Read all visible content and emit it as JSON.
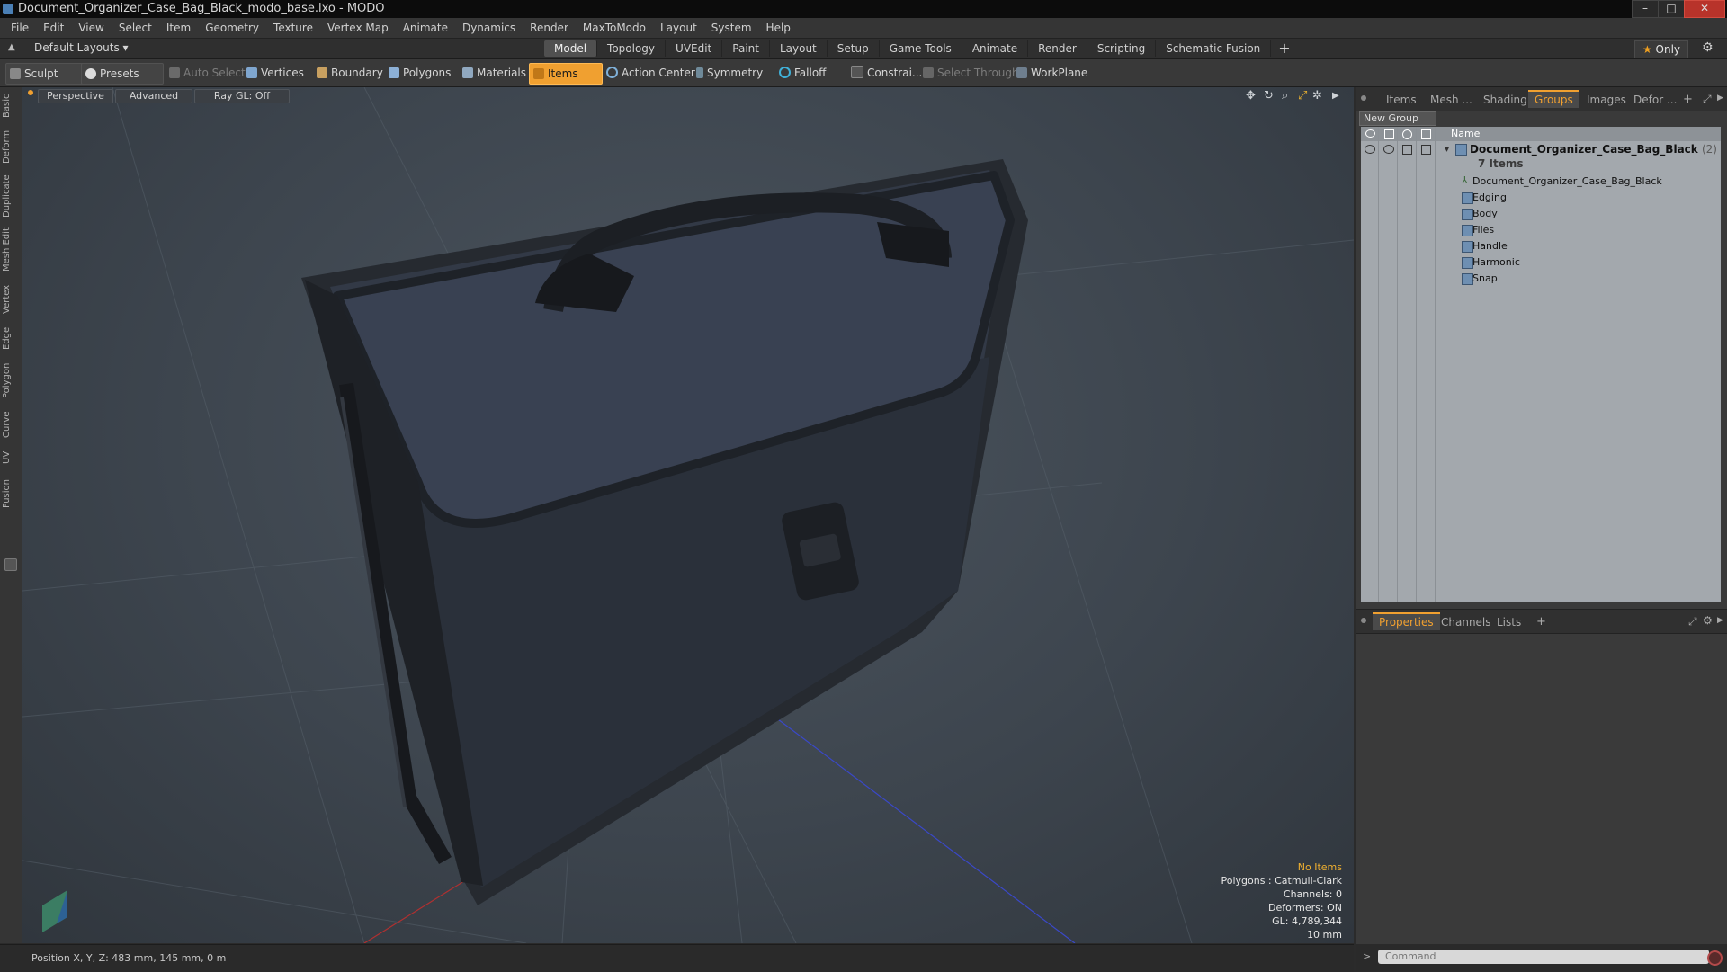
{
  "window": {
    "title": "Document_Organizer_Case_Bag_Black_modo_base.lxo - MODO",
    "controls": [
      "–",
      "□",
      "✕"
    ]
  },
  "menu": [
    "File",
    "Edit",
    "View",
    "Select",
    "Item",
    "Geometry",
    "Texture",
    "Vertex Map",
    "Animate",
    "Dynamics",
    "Render",
    "MaxToModo",
    "Layout",
    "System",
    "Help"
  ],
  "layoutbar": {
    "layout": "Default Layouts ▾",
    "tabs": [
      "Model",
      "Topology",
      "UVEdit",
      "Paint",
      "Layout",
      "Setup",
      "Game Tools",
      "Animate",
      "Render",
      "Scripting",
      "Schematic Fusion"
    ],
    "active_tab": "Model",
    "add": "+",
    "only": "Only"
  },
  "toolbar": {
    "sculpt": "Sculpt",
    "presets": "Presets",
    "auto_select": "Auto Select",
    "vertices": "Vertices",
    "boundary": "Boundary",
    "polygons": "Polygons",
    "materials": "Materials",
    "items": "Items",
    "action_center": "Action Center",
    "symmetry": "Symmetry",
    "falloff": "Falloff",
    "constraints": "Constrai...",
    "select_through": "Select Through",
    "workplane": "WorkPlane"
  },
  "left_tabs": [
    "Basic",
    "Deform",
    "Duplicate",
    "Mesh Edit",
    "Vertex",
    "Edge",
    "Polygon",
    "Curve",
    "UV",
    "Fusion"
  ],
  "viewport": {
    "view": "Perspective",
    "shading": "Advanced",
    "raygl": "Ray GL: Off",
    "info": {
      "selection": "No Items",
      "polygons": "Polygons : Catmull-Clark",
      "channels": "Channels: 0",
      "deformers": "Deformers: ON",
      "gl": "GL: 4,789,344",
      "scale": "10 mm"
    }
  },
  "status": {
    "position": "Position X, Y, Z:  483 mm, 145 mm, 0 m"
  },
  "right_panel": {
    "tabs": [
      "Items",
      "Mesh ...",
      "Shading",
      "Groups",
      "Images",
      "Defor ..."
    ],
    "active_tab": "Groups",
    "new_group": "New Group",
    "column_name": "Name",
    "group": {
      "name": "Document_Organizer_Case_Bag_Black",
      "count": "(2)",
      "sub": "7 Items"
    },
    "items": [
      "Document_Organizer_Case_Bag_Black",
      "Edging",
      "Body",
      "Files",
      "Handle",
      "Harmonic",
      "Snap"
    ]
  },
  "props_panel": {
    "tabs": [
      "Properties",
      "Channels",
      "Lists"
    ],
    "active_tab": "Properties",
    "add": "+"
  },
  "command": {
    "placeholder": "Command"
  }
}
